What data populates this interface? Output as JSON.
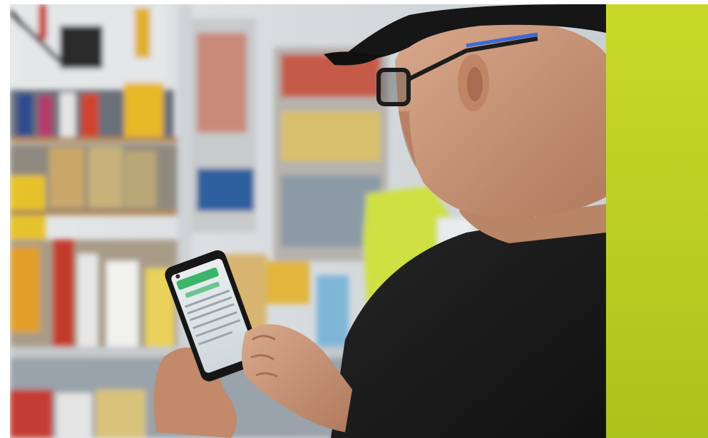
{
  "image": {
    "subject": "person-using-smartphone-in-store",
    "accent_color": "#c3d526",
    "scene_colors": {
      "wall": "#dfe3e6",
      "shirt": "#1c1c1c",
      "cap": "#161616",
      "skin": "#c79679",
      "phone_screen_accent": "#3bb56b",
      "yellow_bag": "#cfe043",
      "shelf_wood": "#b08a5a"
    }
  }
}
